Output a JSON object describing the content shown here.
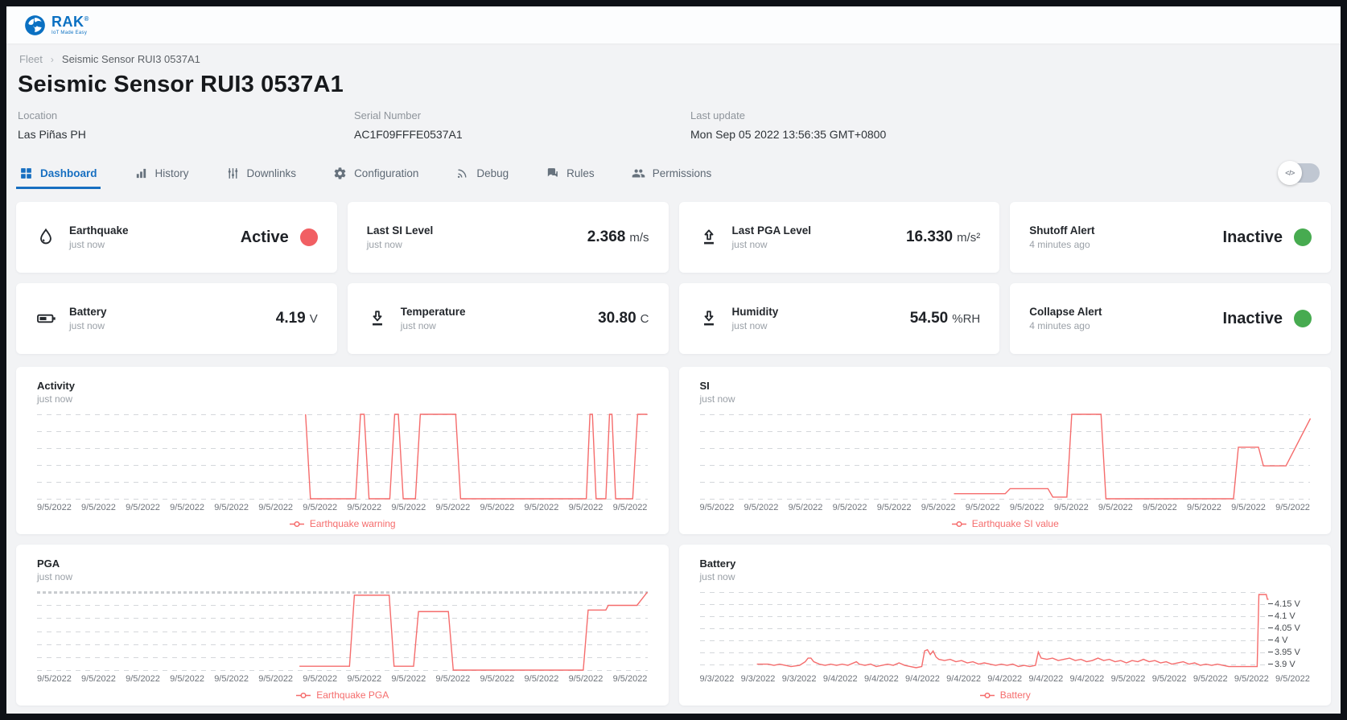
{
  "header": {
    "brand": "RAK",
    "registered": "®",
    "tagline": "IoT Made Easy",
    "logo_icon": "rak-swirl-icon",
    "brand_color": "#0a70c2"
  },
  "breadcrumb": {
    "parent": "Fleet",
    "separator": "›",
    "current": "Seismic Sensor RUI3 0537A1"
  },
  "page": {
    "title": "Seismic Sensor RUI3 0537A1"
  },
  "meta": [
    {
      "label": "Location",
      "value": "Las Piñas PH"
    },
    {
      "label": "Serial Number",
      "value": "AC1F09FFFE0537A1"
    },
    {
      "label": "Last update",
      "value": "Mon Sep 05 2022 13:56:35 GMT+0800"
    }
  ],
  "tabs": [
    {
      "label": "Dashboard",
      "icon": "dashboard-grid-icon",
      "active": true
    },
    {
      "label": "History",
      "icon": "bar-chart-icon",
      "active": false
    },
    {
      "label": "Downlinks",
      "icon": "vertical-sliders-icon",
      "active": false
    },
    {
      "label": "Configuration",
      "icon": "gear-icon",
      "active": false
    },
    {
      "label": "Debug",
      "icon": "rss-icon",
      "active": false
    },
    {
      "label": "Rules",
      "icon": "chat-bubbles-icon",
      "active": false
    },
    {
      "label": "Permissions",
      "icon": "people-icon",
      "active": false
    }
  ],
  "code_toggle": {
    "state": "off",
    "icon_text": "</>"
  },
  "colors": {
    "accent_blue": "#176fc1",
    "line_red": "#f56c6c",
    "status_red": "#f15f63",
    "status_green": "#47ab50"
  },
  "status_cards": [
    {
      "title": "Earthquake",
      "subtitle": "just now",
      "icon": "water-drop-icon",
      "status": "Active",
      "status_color": "#f15f63"
    },
    {
      "title": "Last SI Level",
      "subtitle": "just now",
      "value": "2.368",
      "unit": "m/s"
    },
    {
      "title": "Last PGA Level",
      "subtitle": "just now",
      "icon": "upload-icon",
      "value": "16.330",
      "unit": "m/s²"
    },
    {
      "title": "Shutoff Alert",
      "subtitle": "4 minutes ago",
      "status": "Inactive",
      "status_color": "#47ab50"
    },
    {
      "title": "Battery",
      "subtitle": "just now",
      "icon": "battery-icon",
      "value": "4.19",
      "unit": "V"
    },
    {
      "title": "Temperature",
      "subtitle": "just now",
      "icon": "download-icon",
      "value": "30.80",
      "unit": "C"
    },
    {
      "title": "Humidity",
      "subtitle": "just now",
      "icon": "download-icon",
      "value": "54.50",
      "unit": "%RH"
    },
    {
      "title": "Collapse Alert",
      "subtitle": "4 minutes ago",
      "status": "Inactive",
      "status_color": "#47ab50"
    }
  ],
  "chart_data": [
    {
      "id": "activity",
      "type": "line",
      "title": "Activity",
      "subtitle": "just now",
      "legend": "Earthquake warning",
      "color": "#f56c6c",
      "grid_on": true,
      "grid_fractions": [
        0,
        0.2,
        0.4,
        0.6,
        0.8,
        1
      ],
      "dense_top": false,
      "ylim": [
        0,
        1
      ],
      "y_ticks": [],
      "note": "binary earthquake-warning flag read from plot; 1 = warning active, 0 = inactive; x = fraction of time window (%)",
      "x_labels": [
        "9/5/2022",
        "9/5/2022",
        "9/5/2022",
        "9/5/2022",
        "9/5/2022",
        "9/5/2022",
        "9/5/2022",
        "9/5/2022",
        "9/5/2022",
        "9/5/2022",
        "9/5/2022",
        "9/5/2022",
        "9/5/2022",
        "9/5/2022"
      ],
      "points": [
        [
          44,
          1
        ],
        [
          44.8,
          0
        ],
        [
          52.2,
          0
        ],
        [
          53,
          1
        ],
        [
          53.6,
          1
        ],
        [
          54.4,
          0
        ],
        [
          57.8,
          0
        ],
        [
          58.6,
          1
        ],
        [
          59.2,
          1
        ],
        [
          60,
          0
        ],
        [
          62,
          0
        ],
        [
          62.8,
          1
        ],
        [
          68.6,
          1
        ],
        [
          69.4,
          0
        ],
        [
          90,
          0
        ],
        [
          90.6,
          1
        ],
        [
          91,
          1
        ],
        [
          91.6,
          0
        ],
        [
          93.2,
          0
        ],
        [
          93.8,
          1
        ],
        [
          94.2,
          1
        ],
        [
          94.8,
          0
        ],
        [
          97.6,
          0
        ],
        [
          98.4,
          1
        ],
        [
          100,
          1
        ]
      ]
    },
    {
      "id": "si",
      "type": "line",
      "title": "SI",
      "subtitle": "just now",
      "legend": "Earthquake SI value",
      "color": "#f56c6c",
      "grid_on": true,
      "grid_fractions": [
        0,
        0.2,
        0.4,
        0.6,
        0.8,
        1
      ],
      "dense_top": false,
      "ylim": [
        0,
        1
      ],
      "y_ticks": [],
      "note": "SI value normalized to plot height (no y-axis labels shown); x = fraction of time window (%)",
      "x_labels": [
        "9/5/2022",
        "9/5/2022",
        "9/5/2022",
        "9/5/2022",
        "9/5/2022",
        "9/5/2022",
        "9/5/2022",
        "9/5/2022",
        "9/5/2022",
        "9/5/2022",
        "9/5/2022",
        "9/5/2022",
        "9/5/2022",
        "9/5/2022"
      ],
      "points": [
        [
          41.6,
          0.06
        ],
        [
          50,
          0.06
        ],
        [
          50.8,
          0.12
        ],
        [
          57,
          0.12
        ],
        [
          57.8,
          0.02
        ],
        [
          60.1,
          0.02
        ],
        [
          60.9,
          1
        ],
        [
          65.7,
          1
        ],
        [
          66.5,
          0
        ],
        [
          87.4,
          0
        ],
        [
          88.2,
          0.61
        ],
        [
          91.5,
          0.61
        ],
        [
          92.3,
          0.39
        ],
        [
          96,
          0.39
        ],
        [
          100,
          0.95
        ]
      ]
    },
    {
      "id": "pga",
      "type": "line",
      "title": "PGA",
      "subtitle": "just now",
      "legend": "Earthquake PGA",
      "color": "#f56c6c",
      "grid_on": true,
      "grid_fractions": [
        0,
        0.1667,
        0.3333,
        0.5,
        0.6667,
        0.8333,
        1
      ],
      "dense_top": true,
      "ylim": [
        0,
        1
      ],
      "y_ticks": [],
      "note": "PGA value normalized to plot height (no y-axis labels shown); x = fraction of time window (%)",
      "x_labels": [
        "9/5/2022",
        "9/5/2022",
        "9/5/2022",
        "9/5/2022",
        "9/5/2022",
        "9/5/2022",
        "9/5/2022",
        "9/5/2022",
        "9/5/2022",
        "9/5/2022",
        "9/5/2022",
        "9/5/2022",
        "9/5/2022",
        "9/5/2022"
      ],
      "points": [
        [
          43,
          0.05
        ],
        [
          51.2,
          0.05
        ],
        [
          52,
          0.96
        ],
        [
          57.7,
          0.96
        ],
        [
          58.5,
          0.05
        ],
        [
          61.7,
          0.05
        ],
        [
          62.5,
          0.75
        ],
        [
          67.4,
          0.75
        ],
        [
          68.2,
          0
        ],
        [
          89.5,
          0
        ],
        [
          90.3,
          0.77
        ],
        [
          93.2,
          0.77
        ],
        [
          93.6,
          0.83
        ],
        [
          98.3,
          0.83
        ],
        [
          100,
          1
        ]
      ]
    },
    {
      "id": "battery",
      "type": "line",
      "title": "Battery",
      "subtitle": "just now",
      "legend": "Battery",
      "color": "#f56c6c",
      "grid_on": true,
      "grid_fractions": [
        0,
        0.1538,
        0.3077,
        0.4615,
        0.6154,
        0.7692,
        0.9231
      ],
      "dense_top": false,
      "ylim": [
        3.875,
        4.2
      ],
      "ylabel": "V",
      "y_ticks": [
        {
          "frac": 0.1538,
          "label": "4.15 V"
        },
        {
          "frac": 0.3077,
          "label": "4.1 V"
        },
        {
          "frac": 0.4615,
          "label": "4.05 V"
        },
        {
          "frac": 0.6154,
          "label": "4 V"
        },
        {
          "frac": 0.7692,
          "label": "3.95 V"
        },
        {
          "frac": 0.9231,
          "label": "3.9 V"
        }
      ],
      "note": "battery voltage in volts; x = fraction of time window (%)",
      "x_labels": [
        "9/3/2022",
        "9/3/2022",
        "9/3/2022",
        "9/4/2022",
        "9/4/2022",
        "9/4/2022",
        "9/4/2022",
        "9/4/2022",
        "9/4/2022",
        "9/4/2022",
        "9/5/2022",
        "9/5/2022",
        "9/5/2022",
        "9/5/2022",
        "9/5/2022"
      ],
      "points": [
        [
          10,
          3.9
        ],
        [
          12,
          3.9
        ],
        [
          13,
          3.895
        ],
        [
          14,
          3.9
        ],
        [
          15,
          3.895
        ],
        [
          16,
          3.89
        ],
        [
          17.5,
          3.895
        ],
        [
          18.5,
          3.91
        ],
        [
          19,
          3.925
        ],
        [
          19.5,
          3.925
        ],
        [
          20,
          3.91
        ],
        [
          21,
          3.9
        ],
        [
          22,
          3.895
        ],
        [
          23,
          3.9
        ],
        [
          24,
          3.895
        ],
        [
          25,
          3.9
        ],
        [
          26,
          3.895
        ],
        [
          27.5,
          3.91
        ],
        [
          28,
          3.9
        ],
        [
          29,
          3.895
        ],
        [
          30,
          3.9
        ],
        [
          31,
          3.89
        ],
        [
          32,
          3.895
        ],
        [
          33,
          3.9
        ],
        [
          34,
          3.895
        ],
        [
          35,
          3.905
        ],
        [
          36,
          3.895
        ],
        [
          37,
          3.89
        ],
        [
          38,
          3.885
        ],
        [
          39,
          3.89
        ],
        [
          39.5,
          3.955
        ],
        [
          40,
          3.96
        ],
        [
          40.5,
          3.94
        ],
        [
          41,
          3.955
        ],
        [
          41.5,
          3.93
        ],
        [
          42,
          3.92
        ],
        [
          43,
          3.915
        ],
        [
          44,
          3.92
        ],
        [
          45,
          3.91
        ],
        [
          46,
          3.915
        ],
        [
          47,
          3.905
        ],
        [
          48,
          3.91
        ],
        [
          49,
          3.9
        ],
        [
          50,
          3.905
        ],
        [
          51,
          3.9
        ],
        [
          52,
          3.895
        ],
        [
          53,
          3.9
        ],
        [
          54,
          3.895
        ],
        [
          55,
          3.9
        ],
        [
          56,
          3.89
        ],
        [
          57,
          3.895
        ],
        [
          58,
          3.89
        ],
        [
          59,
          3.895
        ],
        [
          59.5,
          3.95
        ],
        [
          60,
          3.925
        ],
        [
          61,
          3.92
        ],
        [
          62,
          3.925
        ],
        [
          63,
          3.915
        ],
        [
          64,
          3.92
        ],
        [
          65,
          3.925
        ],
        [
          66,
          3.915
        ],
        [
          67,
          3.92
        ],
        [
          68,
          3.91
        ],
        [
          69,
          3.915
        ],
        [
          70,
          3.925
        ],
        [
          71,
          3.915
        ],
        [
          72,
          3.92
        ],
        [
          73,
          3.91
        ],
        [
          74,
          3.915
        ],
        [
          75,
          3.905
        ],
        [
          76,
          3.915
        ],
        [
          77,
          3.91
        ],
        [
          78,
          3.92
        ],
        [
          79,
          3.91
        ],
        [
          80,
          3.915
        ],
        [
          81,
          3.905
        ],
        [
          82,
          3.91
        ],
        [
          83,
          3.9
        ],
        [
          84,
          3.905
        ],
        [
          85,
          3.91
        ],
        [
          86,
          3.9
        ],
        [
          87,
          3.905
        ],
        [
          88,
          3.895
        ],
        [
          89,
          3.9
        ],
        [
          90,
          3.895
        ],
        [
          91,
          3.9
        ],
        [
          92,
          3.895
        ],
        [
          93,
          3.89
        ],
        [
          94,
          3.89
        ],
        [
          95,
          3.89
        ],
        [
          96,
          3.89
        ],
        [
          97,
          3.89
        ],
        [
          98,
          3.89
        ],
        [
          98.3,
          4.19
        ],
        [
          99.6,
          4.19
        ],
        [
          99.8,
          4.17
        ],
        [
          100,
          4.17
        ]
      ]
    }
  ]
}
